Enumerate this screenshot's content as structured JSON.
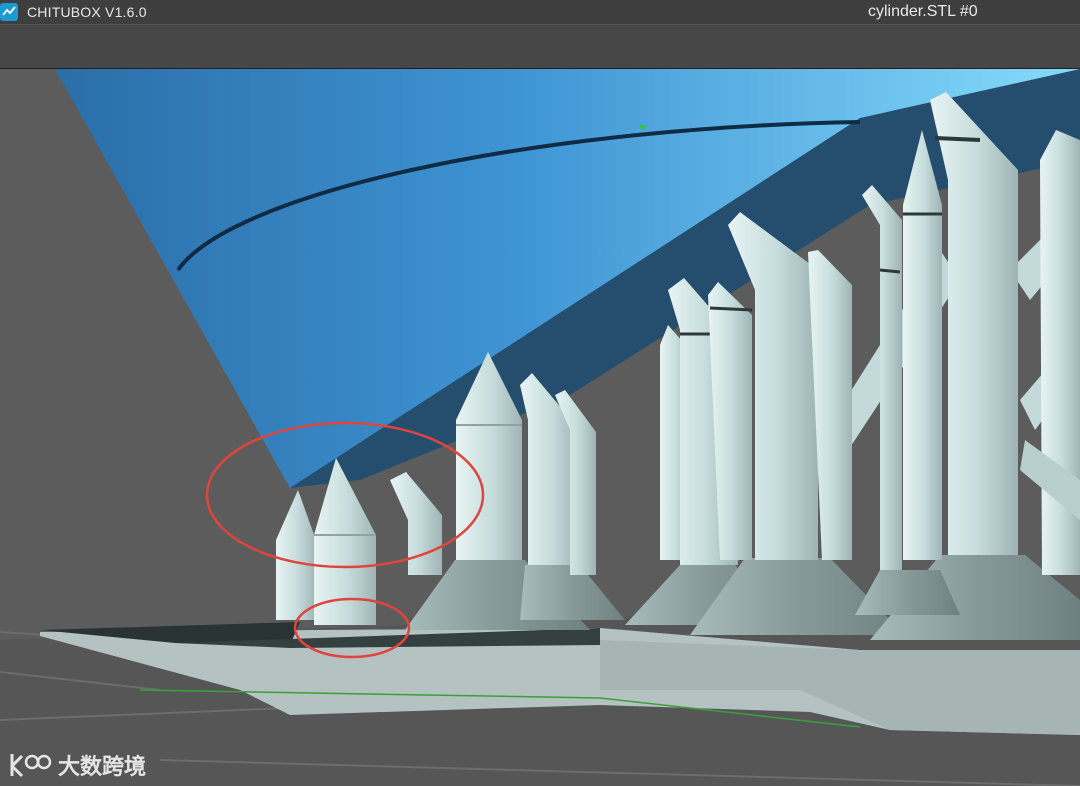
{
  "titlebar": {
    "app_name": "CHITUBOX V1.6.0",
    "document_name": "cylinder.STL #0"
  },
  "watermark": {
    "text": "大数跨境"
  },
  "icons": [
    "chitubox-logo-icon",
    "watermark-logo-icon"
  ],
  "colors": {
    "model_blue": "#3f94d4",
    "support_gray": "#c9dede",
    "plate_gray": "#b5c2c2",
    "highlight_red": "#e0453d",
    "background": "#5c5c5c"
  }
}
